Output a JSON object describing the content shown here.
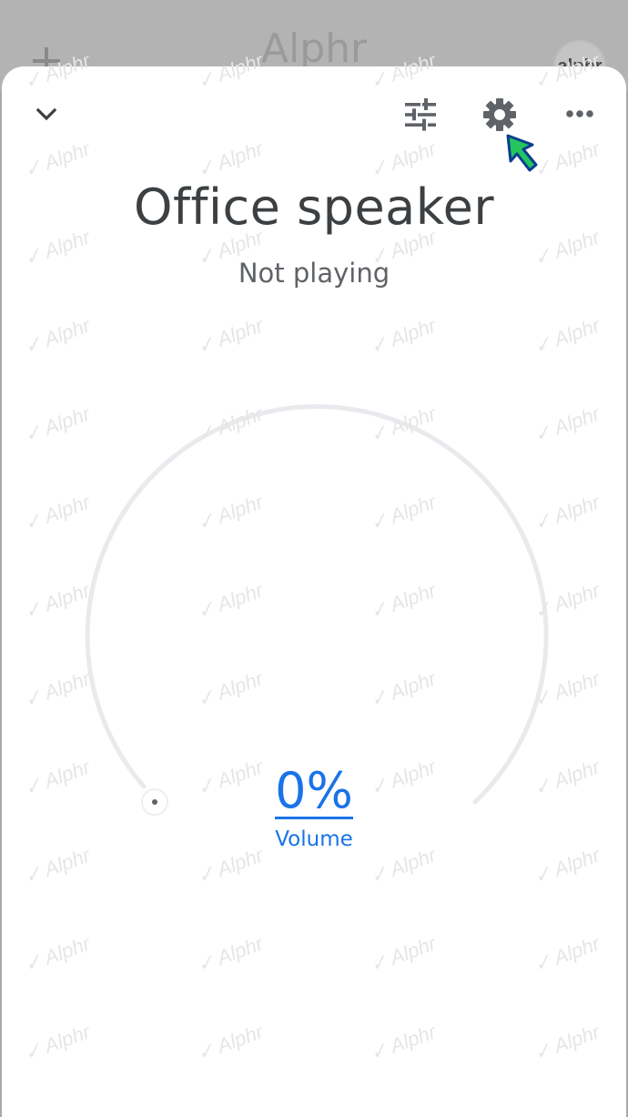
{
  "background": {
    "app_title": "Alphr",
    "avatar_text": "alphr"
  },
  "toolbar": {
    "collapse_icon": "chevron-down-icon",
    "equalizer_icon": "tune-icon",
    "settings_icon": "gear-icon",
    "more_icon": "more-horiz-icon"
  },
  "device": {
    "name": "Office speaker",
    "status": "Not playing"
  },
  "volume": {
    "value_text": "0%",
    "label": "Volume",
    "level": 0
  },
  "colors": {
    "accent": "#1a73e8",
    "annotation_arrow": "#22c55e"
  },
  "watermark": "Alphr"
}
